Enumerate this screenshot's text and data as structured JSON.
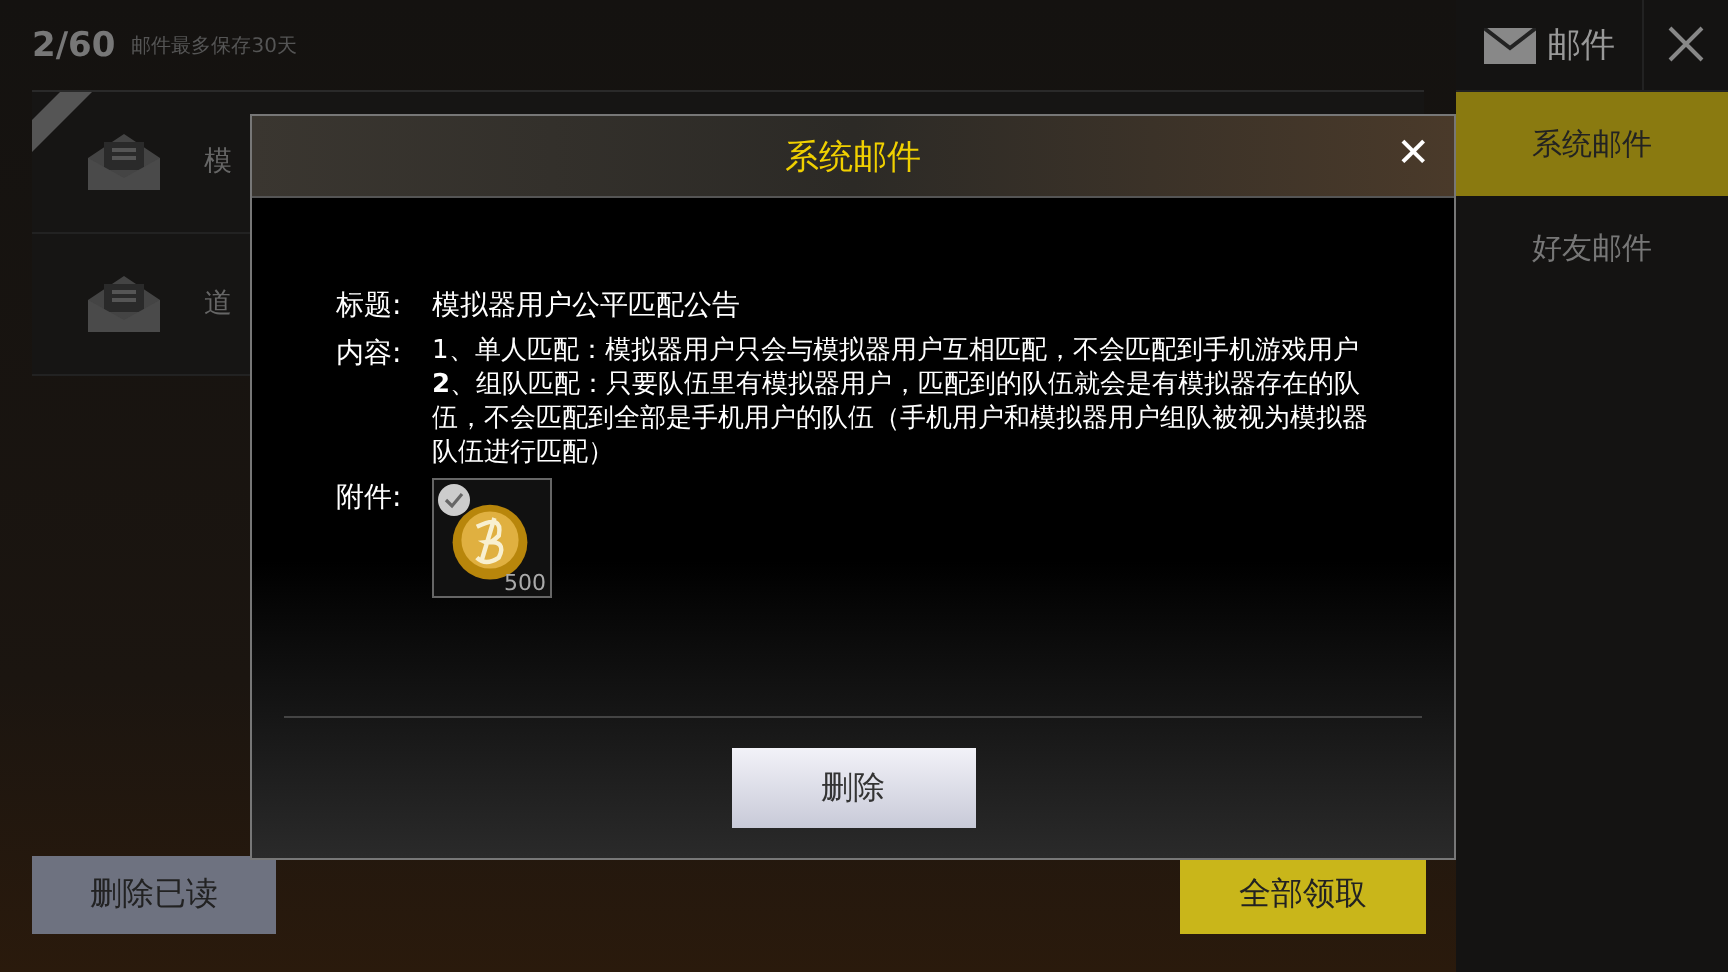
{
  "mailbox": {
    "count": "2/60",
    "note": "邮件最多保存30天",
    "header": "邮件",
    "tabs": [
      {
        "label": "系统邮件",
        "selected": true
      },
      {
        "label": "好友邮件",
        "selected": false
      }
    ],
    "items": [
      {
        "title": "模",
        "new": true
      },
      {
        "title": "道",
        "new": false
      }
    ],
    "delete_read": "删除已读",
    "claim_all": "全部领取"
  },
  "dialog": {
    "title": "系统邮件",
    "close": "✕",
    "subject_label": "标题:",
    "subject": "模拟器用户公平匹配公告",
    "content_label": "内容:",
    "content": [
      "1、单人匹配：模拟器用户只会与模拟器用户互相匹配，不会匹配到手机游戏用户",
      "**2**、组队匹配：只要队伍里有模拟器用户，匹配到的队伍就会是有模拟器存在的队伍，不会匹配到全部是手机用户的队伍（手机用户和模拟器用户组队被视为模拟器队伍进行匹配）"
    ],
    "attachment_label": "附件:",
    "attachments": [
      {
        "quantity": "500",
        "claimed": true
      }
    ],
    "delete": "删除"
  }
}
